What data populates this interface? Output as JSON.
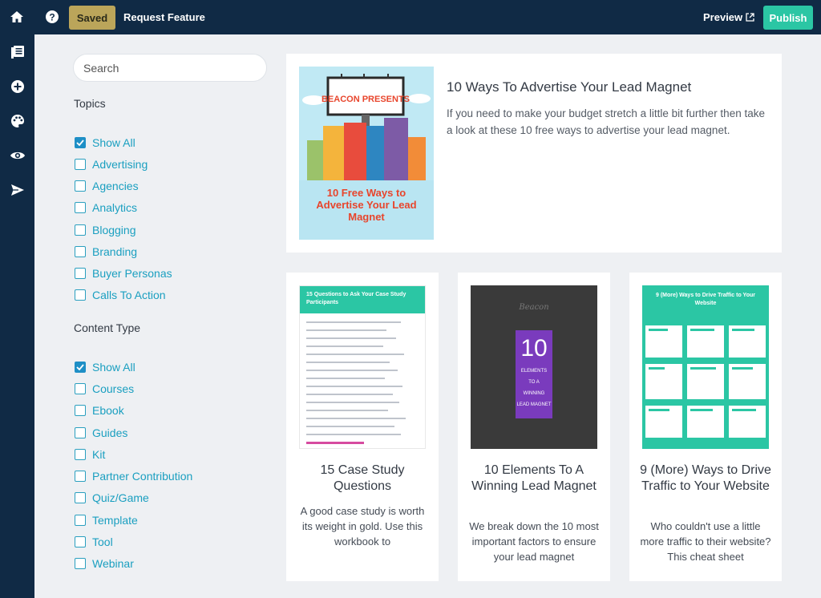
{
  "topbar": {
    "saved_label": "Saved",
    "request_label": "Request Feature",
    "preview_label": "Preview",
    "publish_label": "Publish",
    "icons": [
      "home-icon",
      "help-icon",
      "external-link-icon"
    ]
  },
  "rail": {
    "icons": [
      "pages-icon",
      "add-icon",
      "palette-icon",
      "eye-icon",
      "send-icon"
    ]
  },
  "search": {
    "placeholder": "Search"
  },
  "topics": {
    "title": "Topics",
    "items": [
      {
        "label": "Show All",
        "checked": true
      },
      {
        "label": "Advertising",
        "checked": false
      },
      {
        "label": "Agencies",
        "checked": false
      },
      {
        "label": "Analytics",
        "checked": false
      },
      {
        "label": "Blogging",
        "checked": false
      },
      {
        "label": "Branding",
        "checked": false
      },
      {
        "label": "Buyer Personas",
        "checked": false
      },
      {
        "label": "Calls To Action",
        "checked": false
      }
    ]
  },
  "content_type": {
    "title": "Content Type",
    "items": [
      {
        "label": "Show All",
        "checked": true
      },
      {
        "label": "Courses",
        "checked": false
      },
      {
        "label": "Ebook",
        "checked": false
      },
      {
        "label": "Guides",
        "checked": false
      },
      {
        "label": "Kit",
        "checked": false
      },
      {
        "label": "Partner Contribution",
        "checked": false
      },
      {
        "label": "Quiz/Game",
        "checked": false
      },
      {
        "label": "Template",
        "checked": false
      },
      {
        "label": "Tool",
        "checked": false
      },
      {
        "label": "Webinar",
        "checked": false
      }
    ]
  },
  "featured": {
    "title": "10 Ways To Advertise Your Lead Magnet",
    "description": "If you need to make your budget stretch a little bit further then take a look at these 10 free ways to advertise your lead magnet.",
    "cover_top": "BEACON PRESENTS",
    "cover_bottom": "10 Free Ways to Advertise Your Lead Magnet"
  },
  "cards": [
    {
      "title": "15 Case Study Questions",
      "description": "A good case study is worth its weight in gold. Use this workbook to",
      "thumb_header": "15 Questions to Ask Your Case Study Participants"
    },
    {
      "title": "10 Elements To A Winning Lead Magnet",
      "description": "We break down the 10 most important factors to ensure your lead magnet",
      "thumb_brand": "Beacon",
      "thumb_number": "10",
      "thumb_lines": [
        "ELEMENTS",
        "TO A",
        "WINNING",
        "LEAD MAGNET"
      ]
    },
    {
      "title": "9 (More) Ways to Drive Traffic to Your Website",
      "description": "Who couldn't use a little more traffic to their website? This cheat sheet",
      "thumb_header": "9 (More) Ways to Drive Traffic to Your Website"
    }
  ],
  "colors": {
    "navy": "#102a45",
    "accent_gold": "#bba55a",
    "publish_teal": "#2bc6a4",
    "link_teal": "#1a9fc0",
    "checkbox_blue": "#1e8fc6"
  }
}
